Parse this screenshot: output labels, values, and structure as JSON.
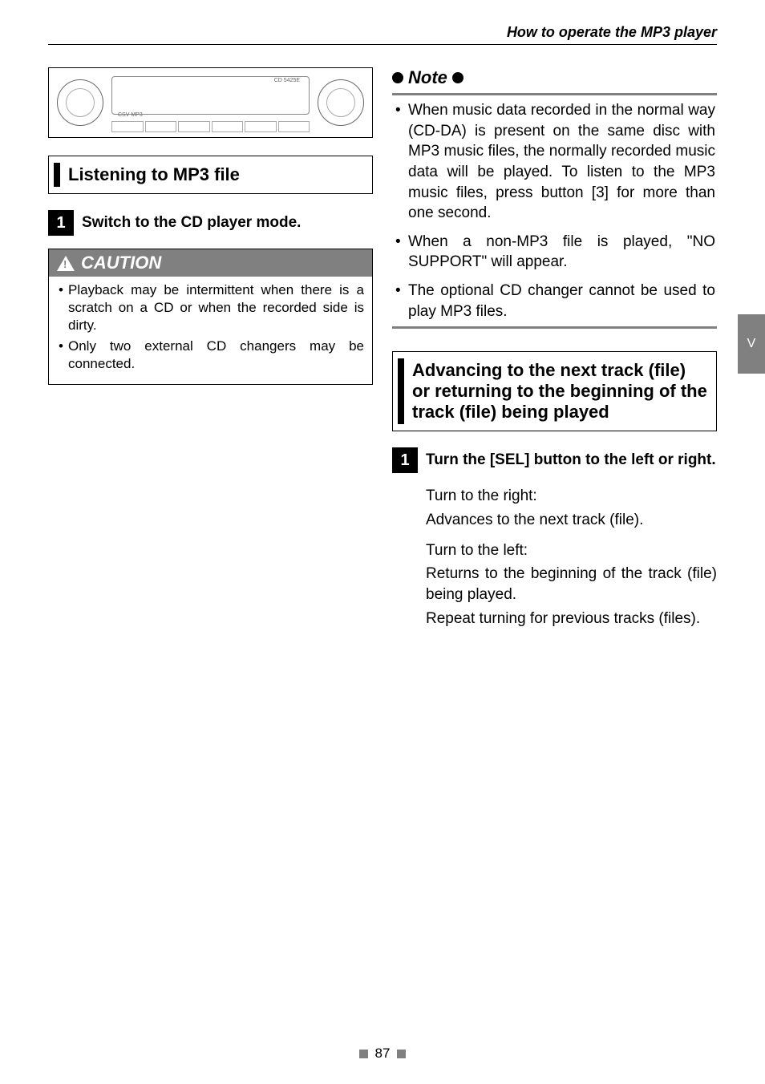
{
  "header": "How to operate the MP3 player",
  "diagram": {
    "label1": "CSV MP3",
    "label2": "CD 5425E"
  },
  "left": {
    "section1": {
      "title": "Listening to MP3 file",
      "step1": {
        "num": "1",
        "text": "Switch to the CD player mode."
      },
      "caution": {
        "label": "CAUTION",
        "items": [
          "Playback may be intermittent when there is a scratch on a CD or when the recorded side is dirty.",
          "Only two external CD changers may be connected."
        ]
      }
    }
  },
  "right": {
    "note": {
      "label": "Note",
      "items": [
        "When music data recorded in the normal way (CD-DA) is present on the same disc with MP3 music files, the normally recorded music data will be played. To listen to the MP3 music files, press button [3] for more than one second.",
        "When a non-MP3 file is played, \"NO SUPPORT\" will appear.",
        "The optional CD changer cannot be used to play MP3 files."
      ]
    },
    "section2": {
      "title": "Advancing to the next track (file) or returning to the beginning of the track (file) being played",
      "step1": {
        "num": "1",
        "text": "Turn the [SEL] button to the left or right.",
        "right_label": "Turn to the right:",
        "right_desc": "Advances to the next track (file).",
        "left_label": "Turn to the left:",
        "left_desc1": "Returns to the beginning of the track (file) being played.",
        "left_desc2": "Repeat turning for previous tracks (files)."
      }
    }
  },
  "side_tab": "V",
  "page_number": "87"
}
